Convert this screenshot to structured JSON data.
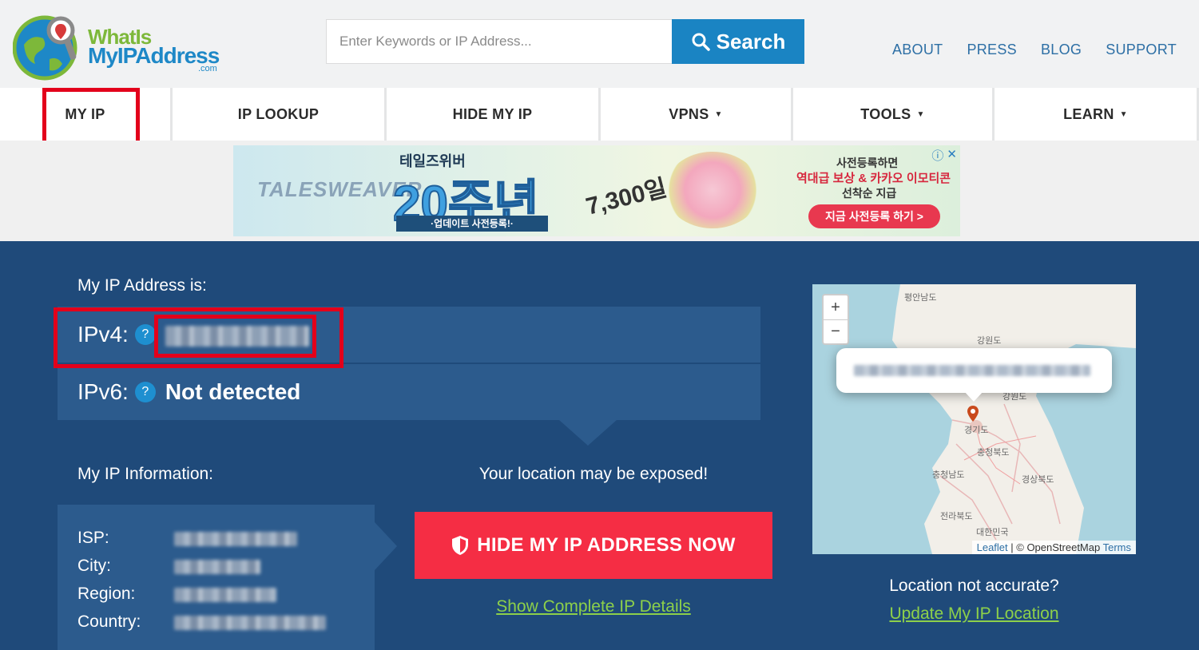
{
  "header": {
    "logo": {
      "line1": "WhatIs",
      "line2": "MyIPAddress",
      "line3": ".com"
    },
    "search": {
      "placeholder": "Enter Keywords or IP Address...",
      "button_label": "Search"
    },
    "top_links": [
      "ABOUT",
      "PRESS",
      "BLOG",
      "SUPPORT"
    ]
  },
  "nav": {
    "items": [
      {
        "label": "MY IP",
        "dropdown": false
      },
      {
        "label": "IP LOOKUP",
        "dropdown": false
      },
      {
        "label": "HIDE MY IP",
        "dropdown": false
      },
      {
        "label": "VPNS",
        "dropdown": true
      },
      {
        "label": "TOOLS",
        "dropdown": true
      },
      {
        "label": "LEARN",
        "dropdown": true
      }
    ],
    "caret": "▼"
  },
  "ad": {
    "logo": "TALESWEAVER",
    "title": "테일즈위버",
    "big": "20주년",
    "banner": "·업데이트 사전등록!·",
    "days": "7,300일",
    "right1": "사전등록하면",
    "right2": "역대급 보상 & 카카오 이모티콘",
    "right3": "선착순 지급",
    "cta": "지금 사전등록 하기 >",
    "controls": [
      "ⓘ",
      "✕"
    ]
  },
  "ip_panel": {
    "label": "My IP Address is:",
    "ipv4_label": "IPv4:",
    "ipv6_label": "IPv6:",
    "ipv6_value": "Not detected",
    "help": "?"
  },
  "info_panel": {
    "label": "My IP Information:",
    "rows": [
      "ISP:",
      "City:",
      "Region:",
      "Country:"
    ]
  },
  "cta": {
    "exposed_text": "Your location may be exposed!",
    "hide_button": "HIDE MY IP ADDRESS NOW",
    "show_details": "Show Complete IP Details"
  },
  "map": {
    "zoom_in": "+",
    "zoom_out": "−",
    "labels": [
      "평안남도",
      "강원도",
      "강원도",
      "경기도",
      "충청북도",
      "충청남도",
      "경상북도",
      "전라북도",
      "대한민국"
    ],
    "attribution_leaflet": "Leaflet",
    "attribution_sep": " | © OpenStreetMap ",
    "attribution_terms": "Terms"
  },
  "location": {
    "question": "Location not accurate?",
    "update_link": "Update My IP Location"
  },
  "colors": {
    "brand_blue": "#1a84c3",
    "panel_bg": "#1f4a7a",
    "row_bg": "#2c5b8d",
    "danger": "#f52d44",
    "link_green": "#8dd04a",
    "highlight_red": "#e3001b"
  }
}
